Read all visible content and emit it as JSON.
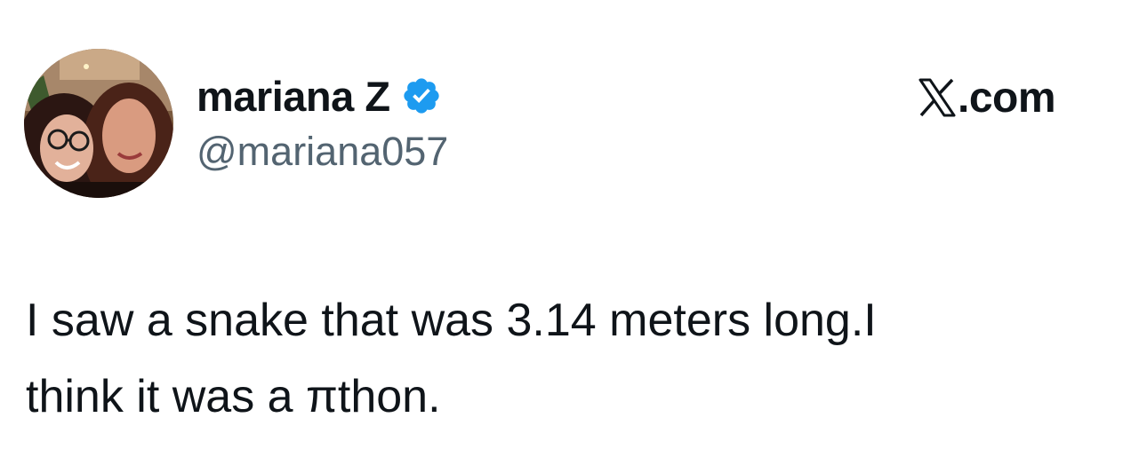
{
  "author": {
    "display_name": "mariana Z",
    "handle": "@mariana057",
    "verified_icon": "verified-badge-icon",
    "verified_color": "#1d9bf0"
  },
  "brand": {
    "logo_icon": "x-logo-icon",
    "text": ".com"
  },
  "tweet": {
    "lines": [
      "I saw a snake that was 3.14 meters long.I",
      "think it was a πthon."
    ]
  },
  "colors": {
    "text_primary": "#0f1419",
    "text_secondary": "#536471",
    "background": "#ffffff"
  }
}
